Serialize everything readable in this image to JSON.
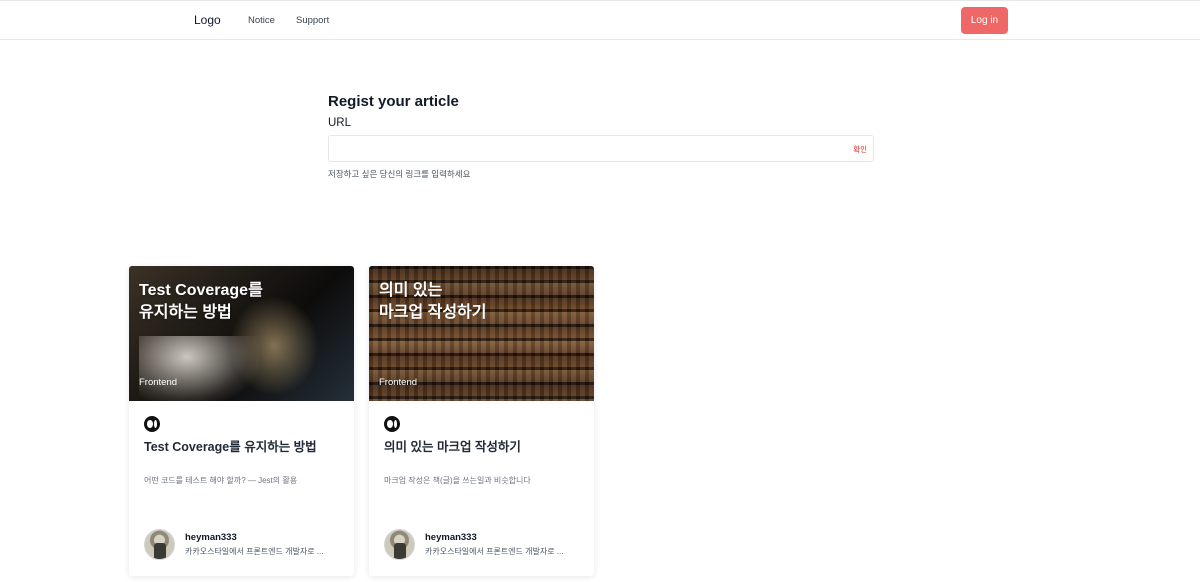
{
  "header": {
    "logo": "Logo",
    "nav": [
      {
        "label": "Notice"
      },
      {
        "label": "Support"
      }
    ],
    "login_label": "Log in",
    "accent_color": "#f06767"
  },
  "register": {
    "title": "Regist your article",
    "url_label": "URL",
    "url_value": "",
    "confirm_label": "확인",
    "helper": "저장하고 싶은 당신의 링크를 입력하세요"
  },
  "articles": [
    {
      "thumb_title_line1": "Test Coverage를",
      "thumb_title_line2": "유지하는 방법",
      "category": "Frontend",
      "source_icon": "medium-icon",
      "title": "Test Coverage를 유지하는 방법",
      "description": "어떤 코드를 테스트 해야 할까? — Jest의 활용",
      "author": {
        "name": "heyman333",
        "bio": "카카오스타일에서 프론트엔드 개발자로 ..."
      }
    },
    {
      "thumb_title_line1": "의미 있는",
      "thumb_title_line2": "마크업 작성하기",
      "category": "Frontend",
      "source_icon": "medium-icon",
      "title": "의미 있는 마크업 작성하기",
      "description": "마크업 작성은 책(글)을 쓰는일과 비슷합니다",
      "author": {
        "name": "heyman333",
        "bio": "카카오스타일에서 프론트엔드 개발자로 ..."
      }
    }
  ]
}
